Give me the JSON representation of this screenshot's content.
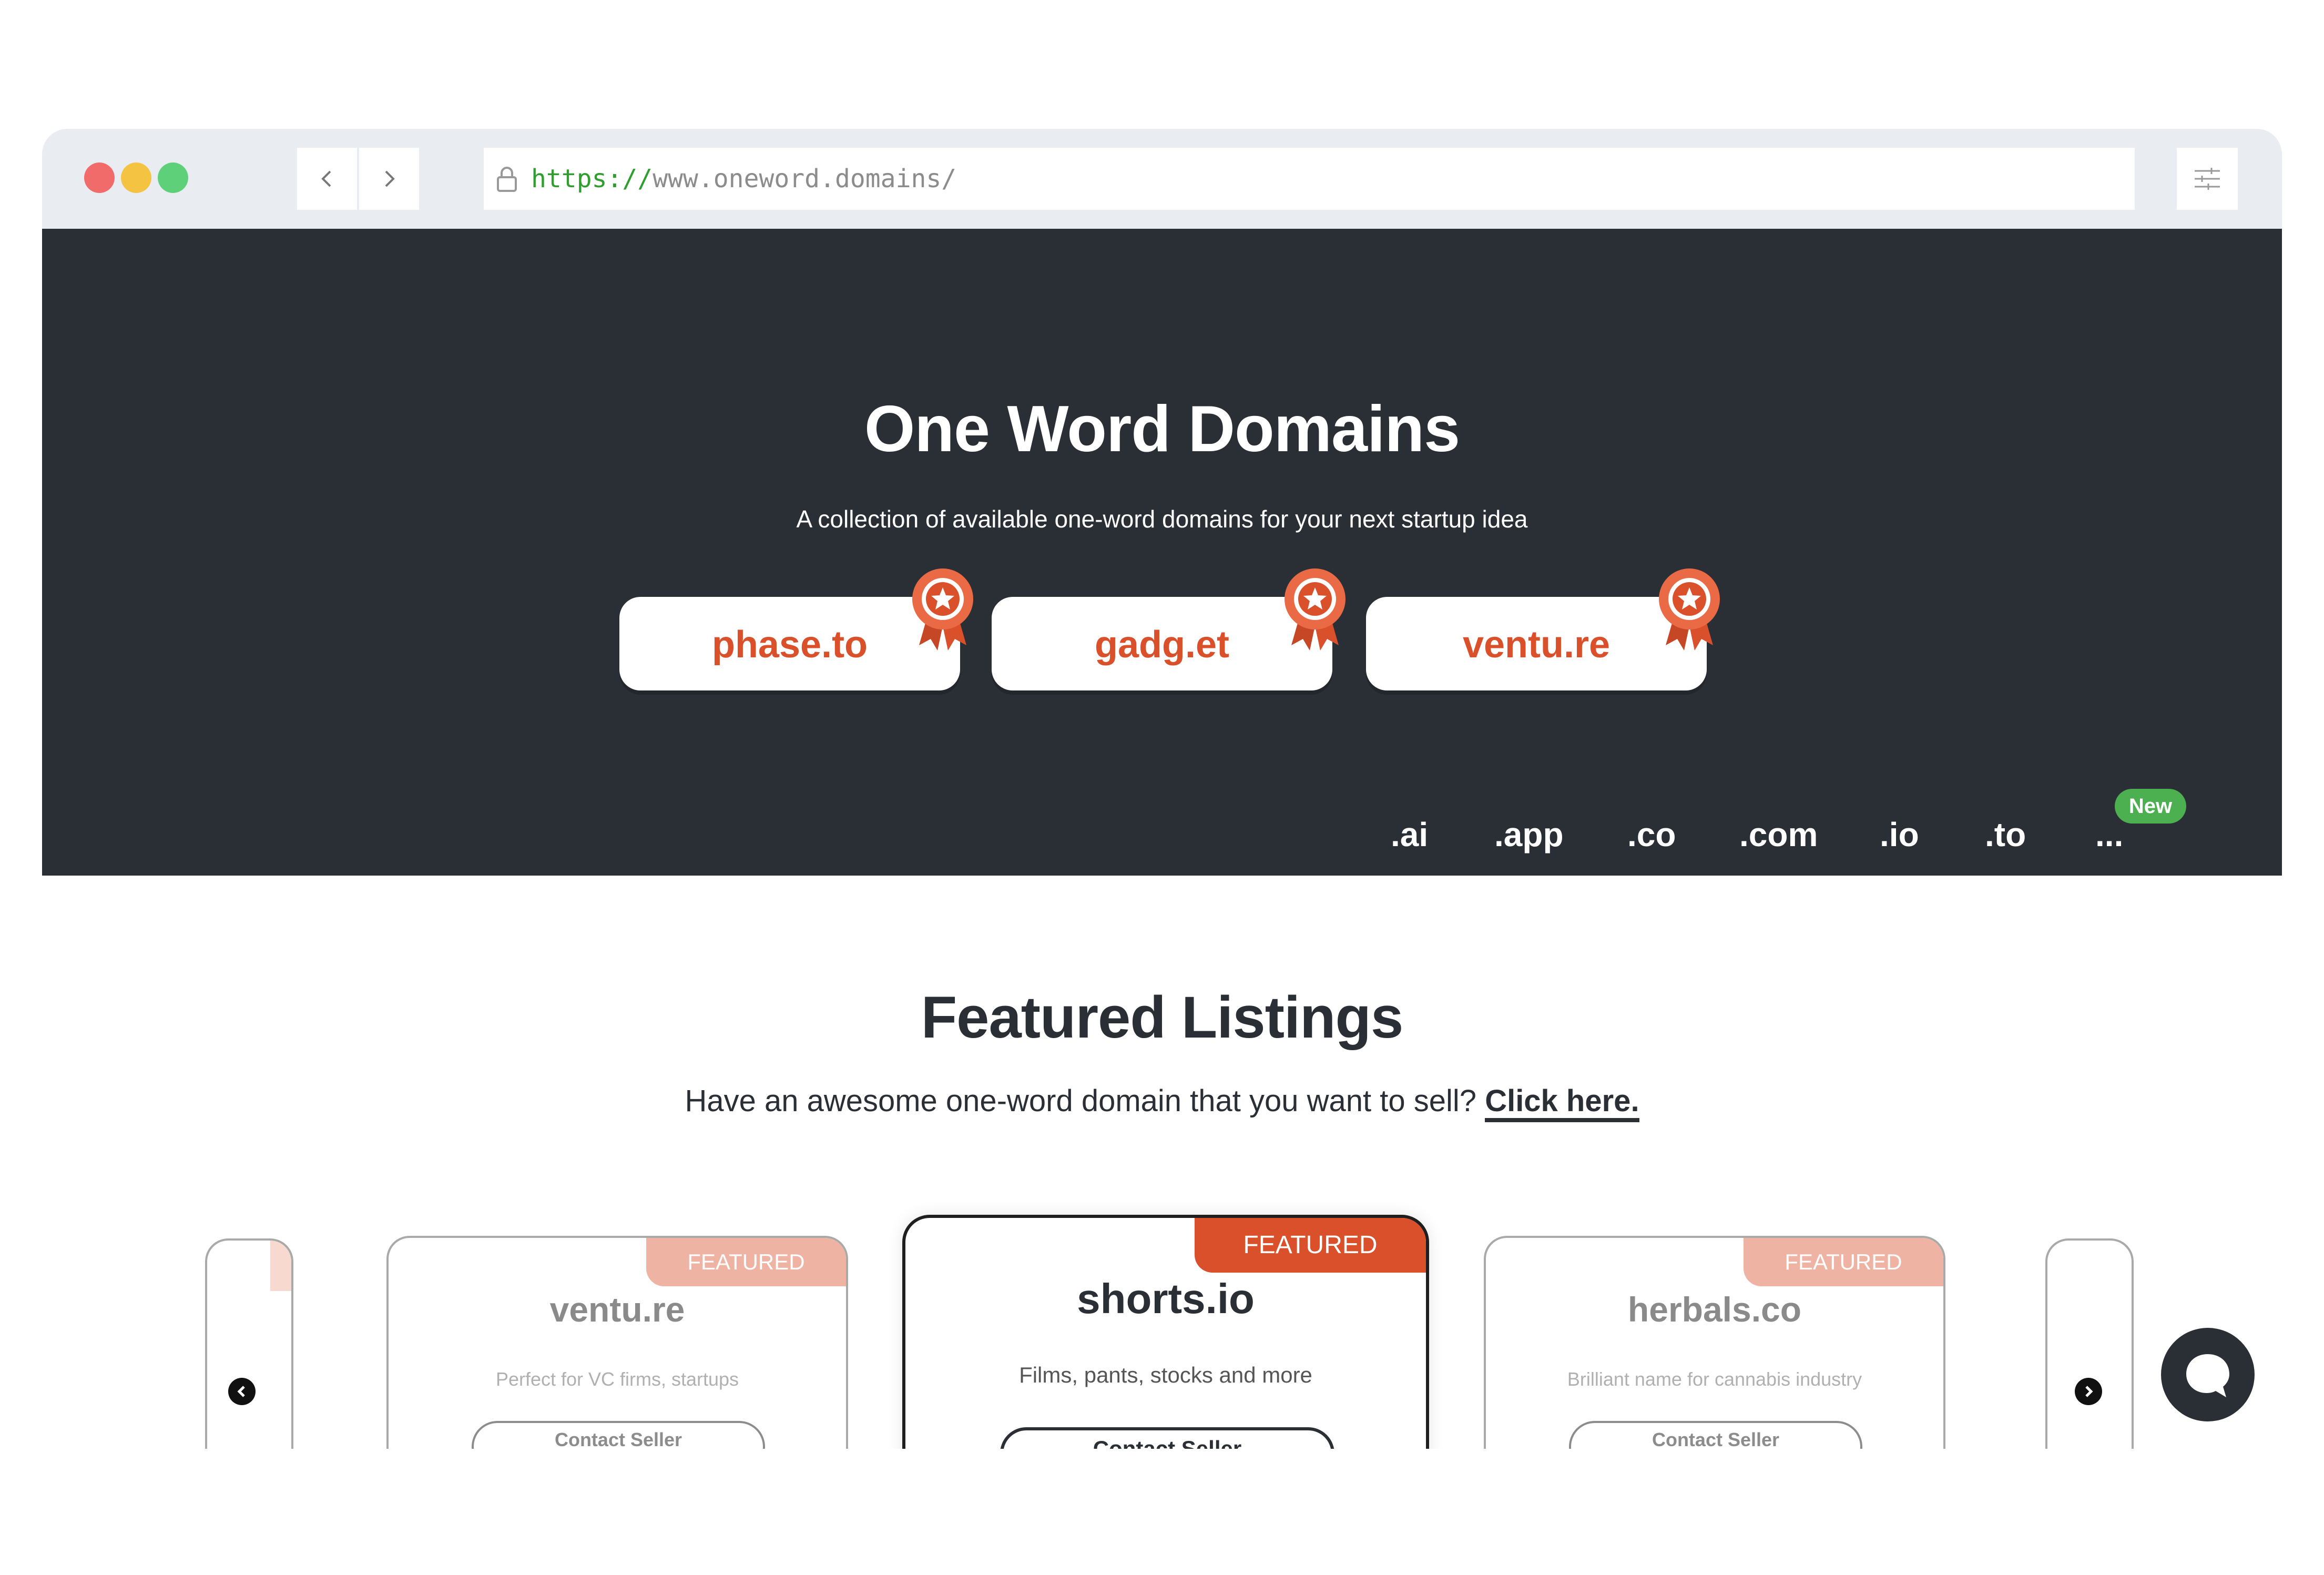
{
  "browser": {
    "url_scheme": "https://",
    "url_host": "www.oneword.domains/",
    "dots": [
      "#f26b6b",
      "#f5c342",
      "#5fd07a"
    ]
  },
  "hero": {
    "title": "One Word Domains",
    "subtitle": "A collection of available one-word domains for your next startup idea",
    "featured_domains": [
      "phase.to",
      "gadg.et",
      "ventu.re"
    ],
    "tlds": [
      ".ai",
      ".app",
      ".co",
      ".com",
      ".io",
      ".to",
      "..."
    ],
    "new_badge": "New"
  },
  "featured": {
    "title": "Featured Listings",
    "subtitle": "Have an awesome one-word domain that you want to sell?",
    "link": "Click here.",
    "badge": "FEATURED",
    "cards": [
      {
        "name": "ventu.re",
        "desc": "Perfect for VC firms, startups",
        "button": "Contact Seller"
      },
      {
        "name": "shorts.io",
        "desc": "Films, pants, stocks and more",
        "button": "Contact Seller"
      },
      {
        "name": "herbals.co",
        "desc": "Brilliant name for cannabis industry",
        "button": "Contact Seller"
      }
    ]
  },
  "colors": {
    "accent": "#d9502b",
    "hero_bg": "#2a2e35",
    "new_green": "#4caf50"
  }
}
